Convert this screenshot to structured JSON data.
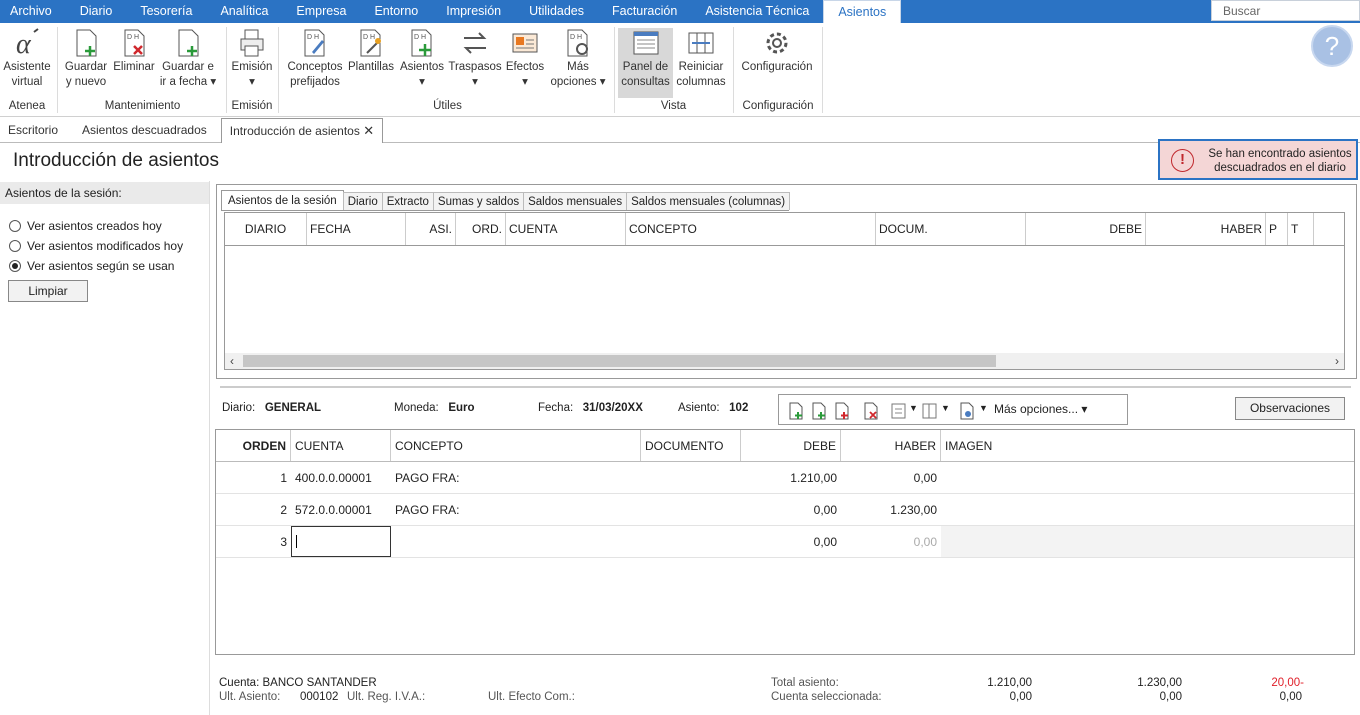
{
  "menu": {
    "items": [
      "Archivo",
      "Diario",
      "Tesorería",
      "Analítica",
      "Empresa",
      "Entorno",
      "Impresión",
      "Utilidades",
      "Facturación",
      "Asistencia Técnica",
      "Asientos"
    ],
    "search_placeholder": "Buscar"
  },
  "ribbon": {
    "asistente": [
      "Asistente",
      "virtual"
    ],
    "guardar_nuevo": [
      "Guardar",
      "y nuevo"
    ],
    "eliminar": [
      "Eliminar",
      ""
    ],
    "guardar_fecha": [
      "Guardar e",
      "ir a fecha ▾"
    ],
    "emision": [
      "Emisión",
      "▾"
    ],
    "conceptos": [
      "Conceptos",
      "prefijados"
    ],
    "plantillas": [
      "Plantillas",
      ""
    ],
    "asientos": [
      "Asientos",
      "▾"
    ],
    "traspasos": [
      "Traspasos",
      "▾"
    ],
    "efectos": [
      "Efectos",
      "▾"
    ],
    "mas_opciones": [
      "Más",
      "opciones ▾"
    ],
    "panel": [
      "Panel de",
      "consultas"
    ],
    "reiniciar": [
      "Reiniciar",
      "columnas"
    ],
    "configuracion": [
      "Configuración",
      ""
    ],
    "groups": [
      "Atenea",
      "Mantenimiento",
      "Emisión",
      "Útiles",
      "Vista",
      "Configuración"
    ],
    "help": "?"
  },
  "tabs": [
    "Escritorio",
    "Asientos descuadrados",
    "Introducción de asientos"
  ],
  "page_title": "Introducción de asientos",
  "alert": {
    "icon": "!",
    "line1": "Se han encontrado asientos",
    "line2": "descuadrados en el diario"
  },
  "left": {
    "heading": "Asientos de la sesión:",
    "radios": [
      "Ver asientos creados hoy",
      "Ver asientos modificados hoy",
      "Ver asientos según se usan"
    ],
    "clear_button": "Limpiar"
  },
  "subtabs": [
    "Asientos de la sesión",
    "Diario",
    "Extracto",
    "Sumas y saldos",
    "Saldos mensuales",
    "Saldos mensuales (columnas)"
  ],
  "grid1_columns": [
    "DIARIO",
    "FECHA",
    "ASI.",
    "ORD.",
    "CUENTA",
    "CONCEPTO",
    "DOCUM.",
    "DEBE",
    "HABER",
    "P",
    "T"
  ],
  "entry": {
    "diario_label": "Diario:",
    "diario_value": "GENERAL",
    "moneda_label": "Moneda:",
    "moneda_value": "Euro",
    "fecha_label": "Fecha:",
    "fecha_value": "31/03/20XX",
    "asiento_label": "Asiento:",
    "asiento_value": "102",
    "more_options": "Más opciones... ▾",
    "observaciones": "Observaciones"
  },
  "grid2_columns": [
    "ORDEN",
    "CUENTA",
    "CONCEPTO",
    "DOCUMENTO",
    "DEBE",
    "HABER",
    "IMAGEN"
  ],
  "grid2_rows": [
    {
      "orden": "1",
      "cuenta": "400.0.0.00001",
      "concepto": "PAGO FRA:",
      "documento": "",
      "debe": "1.210,00",
      "haber": "0,00"
    },
    {
      "orden": "2",
      "cuenta": "572.0.0.00001",
      "concepto": "PAGO FRA:",
      "documento": "",
      "debe": "0,00",
      "haber": "1.230,00"
    },
    {
      "orden": "3",
      "cuenta": "",
      "concepto": "",
      "documento": "",
      "debe": "0,00",
      "haber": "0,00"
    }
  ],
  "footer": {
    "cuenta_label": "Cuenta:",
    "cuenta_value": "BANCO SANTANDER",
    "ult_asiento_label": "Ult. Asiento:",
    "ult_asiento_value": "000102",
    "ult_reg_iva_label": "Ult. Reg. I.V.A.:",
    "ult_efecto_label": "Ult. Efecto Com.:",
    "total_label": "Total asiento:",
    "total_debe": "1.210,00",
    "total_haber": "1.230,00",
    "total_diff": "20,00-",
    "sel_label": "Cuenta seleccionada:",
    "sel_debe": "0,00",
    "sel_haber": "0,00",
    "sel_diff": "0,00"
  },
  "colors": {
    "accent": "#2b73c4",
    "alert_bg": "#f4d6d6",
    "error": "#e0202a"
  }
}
